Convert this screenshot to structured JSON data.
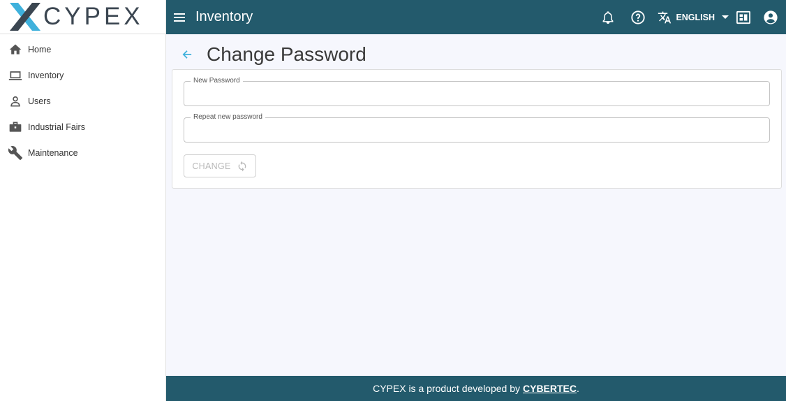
{
  "brand": {
    "logo_text": "CYPEX"
  },
  "sidebar": {
    "items": [
      {
        "label": "Home",
        "icon": "home-icon"
      },
      {
        "label": "Inventory",
        "icon": "laptop-icon"
      },
      {
        "label": "Users",
        "icon": "person-icon"
      },
      {
        "label": "Industrial Fairs",
        "icon": "briefcase-icon"
      },
      {
        "label": "Maintenance",
        "icon": "wrench-icon"
      }
    ]
  },
  "header": {
    "title": "Inventory",
    "language": "ENGLISH",
    "bg_color": "#235a6c"
  },
  "page": {
    "title": "Change Password",
    "fields": {
      "new_password": {
        "label": "New Password",
        "value": ""
      },
      "repeat_password": {
        "label": "Repeat new password",
        "value": ""
      }
    },
    "change_button": "CHANGE"
  },
  "footer": {
    "text": "CYPEX is a product developed by",
    "link": "CYBERTEC",
    "suffix": "."
  },
  "colors": {
    "accent": "#3fb1dc",
    "logo_dark": "#3b4651"
  }
}
